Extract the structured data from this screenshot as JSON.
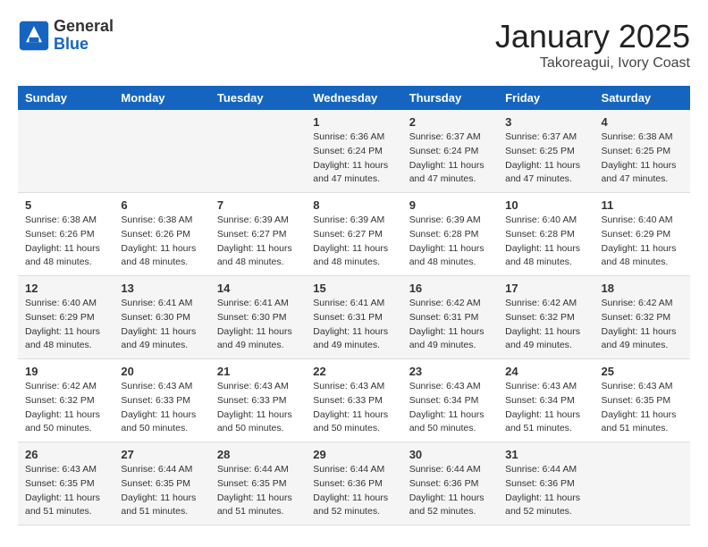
{
  "logo": {
    "general": "General",
    "blue": "Blue"
  },
  "title": "January 2025",
  "location": "Takoreagui, Ivory Coast",
  "days_of_week": [
    "Sunday",
    "Monday",
    "Tuesday",
    "Wednesday",
    "Thursday",
    "Friday",
    "Saturday"
  ],
  "weeks": [
    [
      {
        "day": "",
        "info": ""
      },
      {
        "day": "",
        "info": ""
      },
      {
        "day": "",
        "info": ""
      },
      {
        "day": "1",
        "info": "Sunrise: 6:36 AM\nSunset: 6:24 PM\nDaylight: 11 hours and 47 minutes."
      },
      {
        "day": "2",
        "info": "Sunrise: 6:37 AM\nSunset: 6:24 PM\nDaylight: 11 hours and 47 minutes."
      },
      {
        "day": "3",
        "info": "Sunrise: 6:37 AM\nSunset: 6:25 PM\nDaylight: 11 hours and 47 minutes."
      },
      {
        "day": "4",
        "info": "Sunrise: 6:38 AM\nSunset: 6:25 PM\nDaylight: 11 hours and 47 minutes."
      }
    ],
    [
      {
        "day": "5",
        "info": "Sunrise: 6:38 AM\nSunset: 6:26 PM\nDaylight: 11 hours and 48 minutes."
      },
      {
        "day": "6",
        "info": "Sunrise: 6:38 AM\nSunset: 6:26 PM\nDaylight: 11 hours and 48 minutes."
      },
      {
        "day": "7",
        "info": "Sunrise: 6:39 AM\nSunset: 6:27 PM\nDaylight: 11 hours and 48 minutes."
      },
      {
        "day": "8",
        "info": "Sunrise: 6:39 AM\nSunset: 6:27 PM\nDaylight: 11 hours and 48 minutes."
      },
      {
        "day": "9",
        "info": "Sunrise: 6:39 AM\nSunset: 6:28 PM\nDaylight: 11 hours and 48 minutes."
      },
      {
        "day": "10",
        "info": "Sunrise: 6:40 AM\nSunset: 6:28 PM\nDaylight: 11 hours and 48 minutes."
      },
      {
        "day": "11",
        "info": "Sunrise: 6:40 AM\nSunset: 6:29 PM\nDaylight: 11 hours and 48 minutes."
      }
    ],
    [
      {
        "day": "12",
        "info": "Sunrise: 6:40 AM\nSunset: 6:29 PM\nDaylight: 11 hours and 48 minutes."
      },
      {
        "day": "13",
        "info": "Sunrise: 6:41 AM\nSunset: 6:30 PM\nDaylight: 11 hours and 49 minutes."
      },
      {
        "day": "14",
        "info": "Sunrise: 6:41 AM\nSunset: 6:30 PM\nDaylight: 11 hours and 49 minutes."
      },
      {
        "day": "15",
        "info": "Sunrise: 6:41 AM\nSunset: 6:31 PM\nDaylight: 11 hours and 49 minutes."
      },
      {
        "day": "16",
        "info": "Sunrise: 6:42 AM\nSunset: 6:31 PM\nDaylight: 11 hours and 49 minutes."
      },
      {
        "day": "17",
        "info": "Sunrise: 6:42 AM\nSunset: 6:32 PM\nDaylight: 11 hours and 49 minutes."
      },
      {
        "day": "18",
        "info": "Sunrise: 6:42 AM\nSunset: 6:32 PM\nDaylight: 11 hours and 49 minutes."
      }
    ],
    [
      {
        "day": "19",
        "info": "Sunrise: 6:42 AM\nSunset: 6:32 PM\nDaylight: 11 hours and 50 minutes."
      },
      {
        "day": "20",
        "info": "Sunrise: 6:43 AM\nSunset: 6:33 PM\nDaylight: 11 hours and 50 minutes."
      },
      {
        "day": "21",
        "info": "Sunrise: 6:43 AM\nSunset: 6:33 PM\nDaylight: 11 hours and 50 minutes."
      },
      {
        "day": "22",
        "info": "Sunrise: 6:43 AM\nSunset: 6:33 PM\nDaylight: 11 hours and 50 minutes."
      },
      {
        "day": "23",
        "info": "Sunrise: 6:43 AM\nSunset: 6:34 PM\nDaylight: 11 hours and 50 minutes."
      },
      {
        "day": "24",
        "info": "Sunrise: 6:43 AM\nSunset: 6:34 PM\nDaylight: 11 hours and 51 minutes."
      },
      {
        "day": "25",
        "info": "Sunrise: 6:43 AM\nSunset: 6:35 PM\nDaylight: 11 hours and 51 minutes."
      }
    ],
    [
      {
        "day": "26",
        "info": "Sunrise: 6:43 AM\nSunset: 6:35 PM\nDaylight: 11 hours and 51 minutes."
      },
      {
        "day": "27",
        "info": "Sunrise: 6:44 AM\nSunset: 6:35 PM\nDaylight: 11 hours and 51 minutes."
      },
      {
        "day": "28",
        "info": "Sunrise: 6:44 AM\nSunset: 6:35 PM\nDaylight: 11 hours and 51 minutes."
      },
      {
        "day": "29",
        "info": "Sunrise: 6:44 AM\nSunset: 6:36 PM\nDaylight: 11 hours and 52 minutes."
      },
      {
        "day": "30",
        "info": "Sunrise: 6:44 AM\nSunset: 6:36 PM\nDaylight: 11 hours and 52 minutes."
      },
      {
        "day": "31",
        "info": "Sunrise: 6:44 AM\nSunset: 6:36 PM\nDaylight: 11 hours and 52 minutes."
      },
      {
        "day": "",
        "info": ""
      }
    ]
  ]
}
